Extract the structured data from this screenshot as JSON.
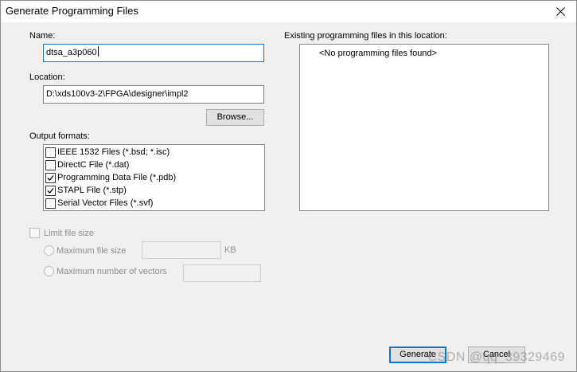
{
  "window": {
    "title": "Generate Programming Files",
    "close_icon": "close-icon"
  },
  "name": {
    "label": "Name:",
    "value": "dtsa_a3p060"
  },
  "location": {
    "label": "Location:",
    "value": "D:\\xds100v3-2\\FPGA\\designer\\impl2",
    "browse_label": "Browse..."
  },
  "output_formats": {
    "label": "Output formats:",
    "items": [
      {
        "label": "IEEE 1532 Files (*.bsd; *.isc)",
        "checked": false
      },
      {
        "label": "DirectC File (*.dat)",
        "checked": false
      },
      {
        "label": "Programming Data File (*.pdb)",
        "checked": true
      },
      {
        "label": "STAPL File (*.stp)",
        "checked": true
      },
      {
        "label": "Serial Vector Files (*.svf)",
        "checked": false
      }
    ]
  },
  "existing": {
    "label": "Existing programming files in this location:",
    "empty_text": "<No programming files found>"
  },
  "limit": {
    "label": "Limit file size",
    "max_file_size_label": "Maximum file size",
    "unit": "KB",
    "max_vectors_label": "Maximum number of vectors"
  },
  "actions": {
    "generate_label": "Generate",
    "cancel_label": "Cancel"
  },
  "watermark": "CSDN @qq_39329469"
}
